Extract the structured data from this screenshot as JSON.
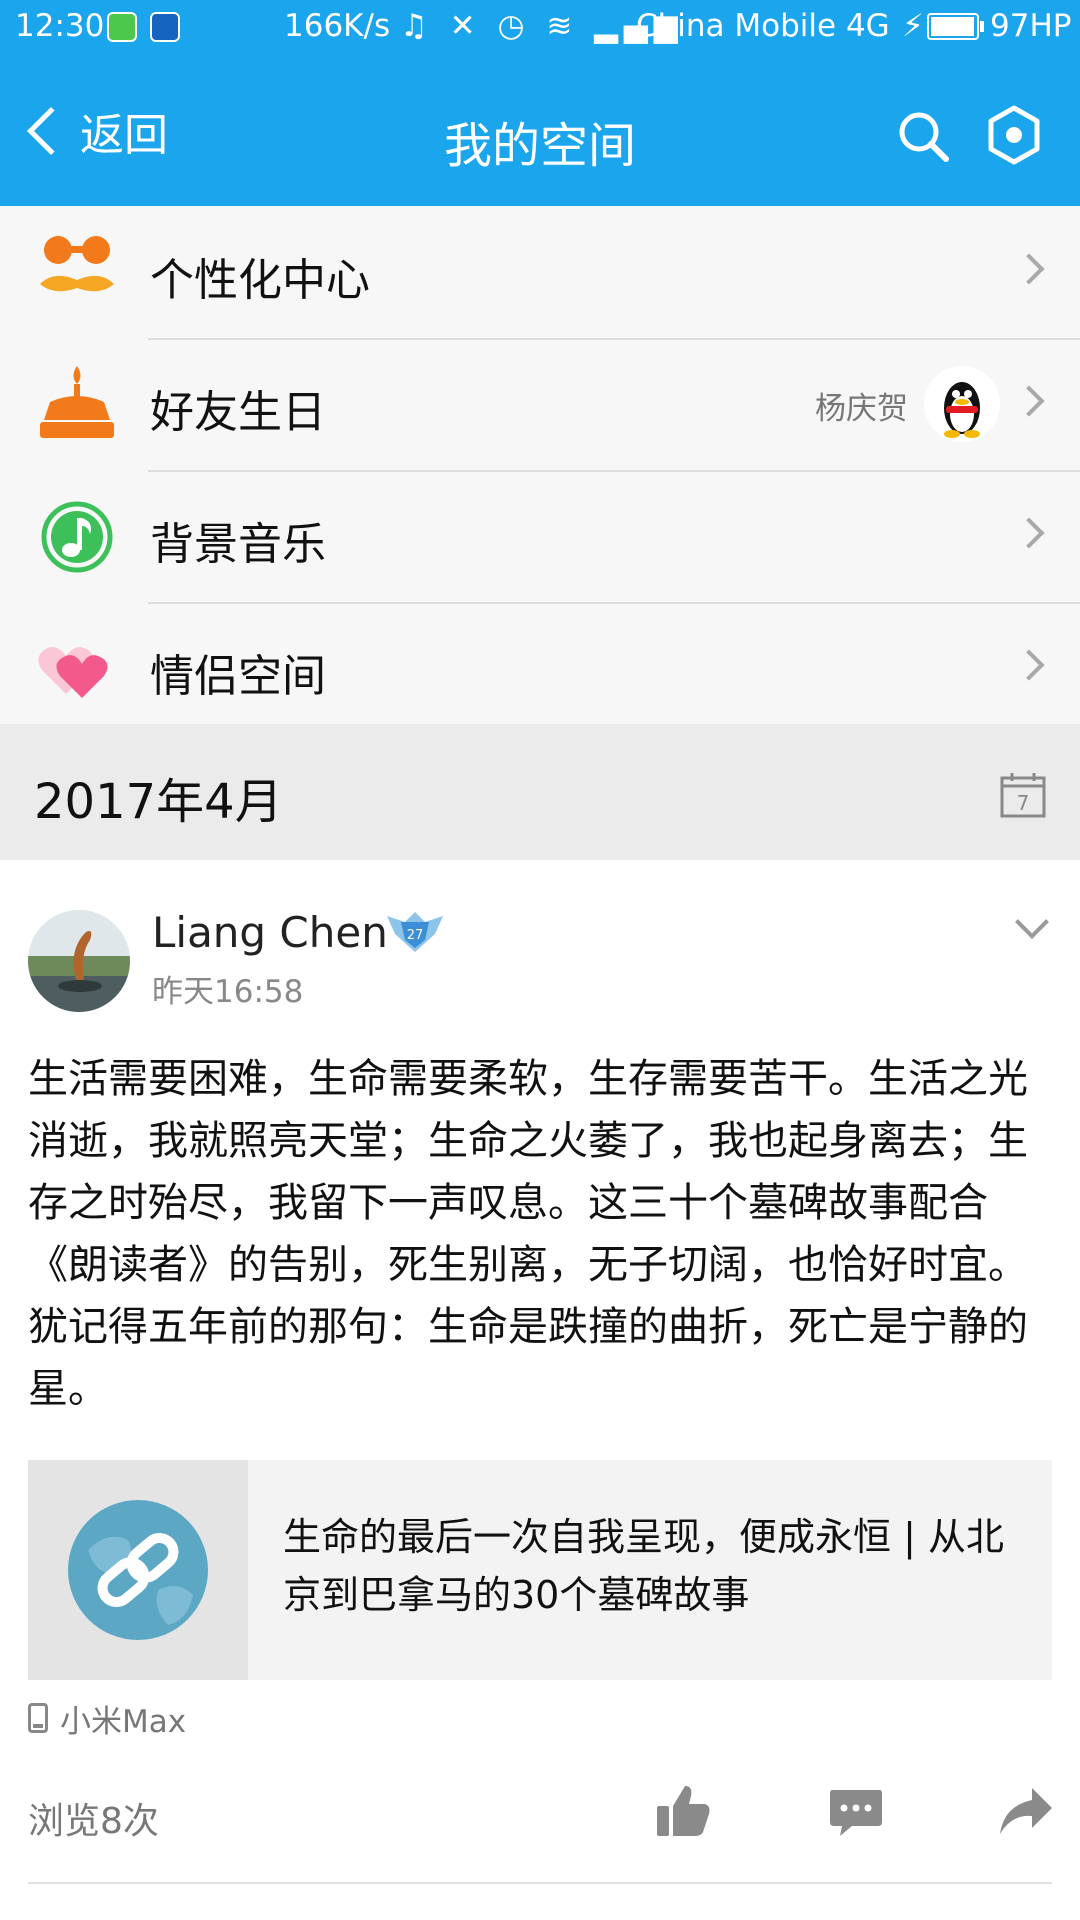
{
  "status_bar": {
    "time": "12:30",
    "network_speed": "166K/s",
    "carrier": "China Mobile 4G",
    "battery": "97HP",
    "battery_level": 0.97
  },
  "nav": {
    "back_label": "返回",
    "title": "我的空间"
  },
  "menu": [
    {
      "label": "个性化中心",
      "icon": "mustache-icon"
    },
    {
      "label": "好友生日",
      "icon": "birthday-cake-icon",
      "extra": "杨庆贺"
    },
    {
      "label": "背景音乐",
      "icon": "music-note-icon"
    },
    {
      "label": "情侣空间",
      "icon": "hearts-icon"
    }
  ],
  "date_header": "2017年4月",
  "calendar_icon_text": "7",
  "post": {
    "author": "Liang Chen",
    "time": "昨天16:58",
    "text": "生活需要困难，生命需要柔软，生存需要苦干。生活之光消逝，我就照亮天堂；生命之火萎了，我也起身离去；生存之时殆尽，我留下一声叹息。这三十个墓碑故事配合《朗读者》的告别，死生别离，无子切阔，也恰好时宜。犹记得五年前的那句：生命是跌撞的曲折，死亡是宁静的星。",
    "link_title": "生命的最后一次自我呈现，便成永恒 | 从北京到巴拿马的30个墓碑故事",
    "device": "小米Max",
    "views": "浏览8次"
  },
  "colors": {
    "brand": "#1aa5ec",
    "orange": "#f27a1a",
    "green": "#3dc05a",
    "pink": "#f25a8c"
  }
}
